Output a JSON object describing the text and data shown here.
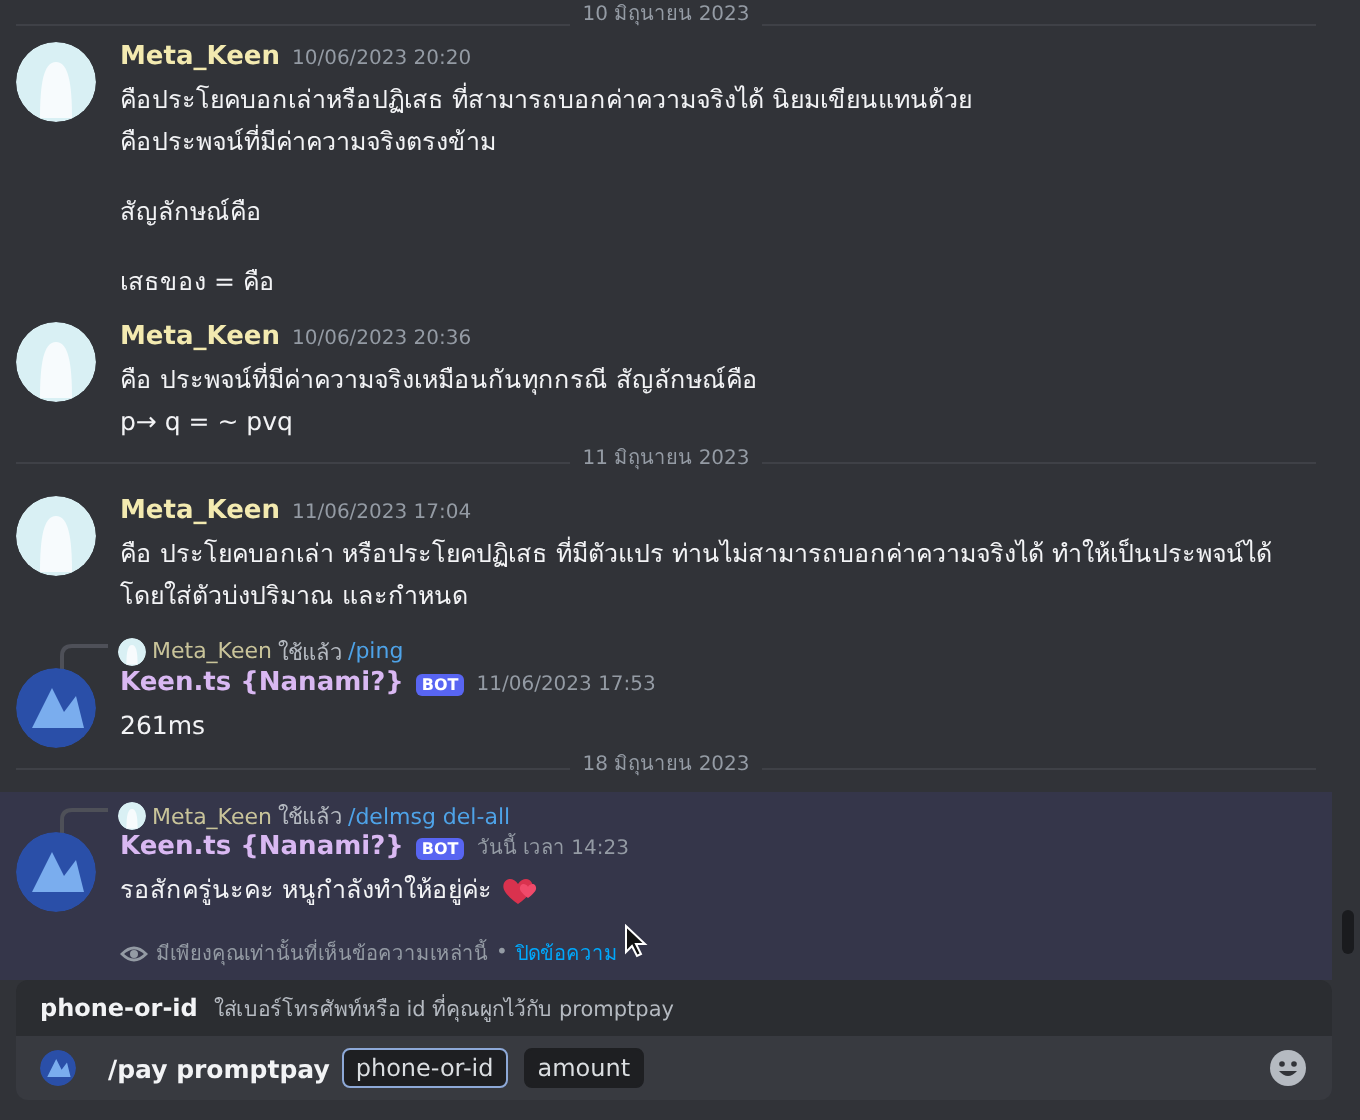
{
  "messages": [
    {
      "kind": "divider",
      "text": "10 มิถุนายน 2023"
    },
    {
      "kind": "message",
      "author": "Meta_Keen",
      "color": "#f3eab0",
      "timestamp": "10/06/2023 20:20",
      "paragraphs": [
        [
          "คือประโยคบอกเล่าหรือปฏิเสธ ที่สามารถบอกค่าความจริงได้ นิยมเขียนแทนด้วย",
          "คือประพจน์ที่มีค่าความจริงตรงข้าม"
        ],
        [
          "สัญลักษณ์คือ"
        ],
        [
          "เสธของ = คือ"
        ]
      ]
    },
    {
      "kind": "message",
      "author": "Meta_Keen",
      "color": "#f3eab0",
      "timestamp": "10/06/2023 20:36",
      "paragraphs": [
        [
          "คือ ประพจน์ที่มีค่าความจริงเหมือนกันทุกกรณี สัญลักษณ์คือ",
          "p→ q = ~ pvq"
        ]
      ]
    },
    {
      "kind": "divider",
      "text": "11 มิถุนายน 2023"
    },
    {
      "kind": "message",
      "author": "Meta_Keen",
      "color": "#f3eab0",
      "timestamp": "11/06/2023 17:04",
      "paragraphs": [
        [
          "คือ ประโยคบอกเล่า หรือประโยคปฏิเสธ ที่มีตัวแปร ท่านไม่สามารถบอกค่าความจริงได้ ทำให้เป็นประพจน์ได้ โดยใส่ตัวบ่งปริมาณ และกำหนด"
        ]
      ]
    },
    {
      "kind": "message",
      "author": "Keen.ts {Nanami?}",
      "color": "#d9b8f2",
      "badge": "BOT",
      "timestamp": "11/06/2023 17:53",
      "reply": {
        "author": "Meta_Keen",
        "verb": "ใช้แล้ว",
        "command": "/ping"
      },
      "paragraphs": [
        [
          "261ms"
        ]
      ]
    },
    {
      "kind": "divider",
      "text": "18 มิถุนายน 2023"
    },
    {
      "kind": "message",
      "author": "Keen.ts {Nanami?}",
      "color": "#d9b8f2",
      "badge": "BOT",
      "timestamp": "วันนี้ เวลา 14:23",
      "highlighted": true,
      "reply": {
        "author": "Meta_Keen",
        "verb": "ใช้แล้ว",
        "command": "/delmsg del-all"
      },
      "paragraphs": [
        [
          "รอสักครู่นะคะ หนูกำลังทำให้อยู่ค่ะ"
        ]
      ],
      "heart": true,
      "note": {
        "text": "มีเพียงคุณเท่านั้นที่เห็นข้อความเหล่านี้",
        "separator": "•",
        "link": "ปิดข้อความ"
      }
    }
  ],
  "option_hint": {
    "name": "phone-or-id",
    "description": "ใส่เบอร์โทรศัพท์หรือ id ที่คุณผูกไว้กับ promptpay"
  },
  "composer": {
    "command": "/pay promptpay",
    "options": [
      {
        "label": "phone-or-id",
        "selected": true
      },
      {
        "label": "amount",
        "selected": false
      }
    ]
  }
}
